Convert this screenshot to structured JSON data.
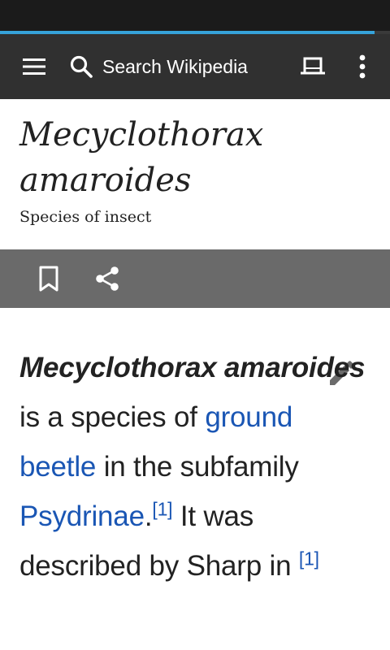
{
  "toolbar": {
    "search_placeholder": "Search Wikipedia",
    "icons": [
      "menu-icon",
      "search-icon",
      "tabs-icon",
      "overflow-menu-icon"
    ]
  },
  "progress": {
    "fraction": 0.96,
    "color": "#36a3da"
  },
  "article": {
    "title": "Mecyclothorax amaroides",
    "description": "Species of insect",
    "lead": {
      "bold_name": "Mecyclothorax amaroides",
      "text1": " is a species of ",
      "link1": "ground beetle",
      "text2": " in the subfamily ",
      "link2": "Psydrinae",
      "text3": ".",
      "ref1": "[1]",
      "text4": " It was described by Sharp in",
      "ref2": "[1]"
    }
  },
  "actions": [
    "bookmark-icon",
    "share-icon",
    "edit-icon"
  ],
  "colors": {
    "toolbar": "#303030",
    "actionbar": "#6a6a6a",
    "link": "#1a56b4"
  }
}
